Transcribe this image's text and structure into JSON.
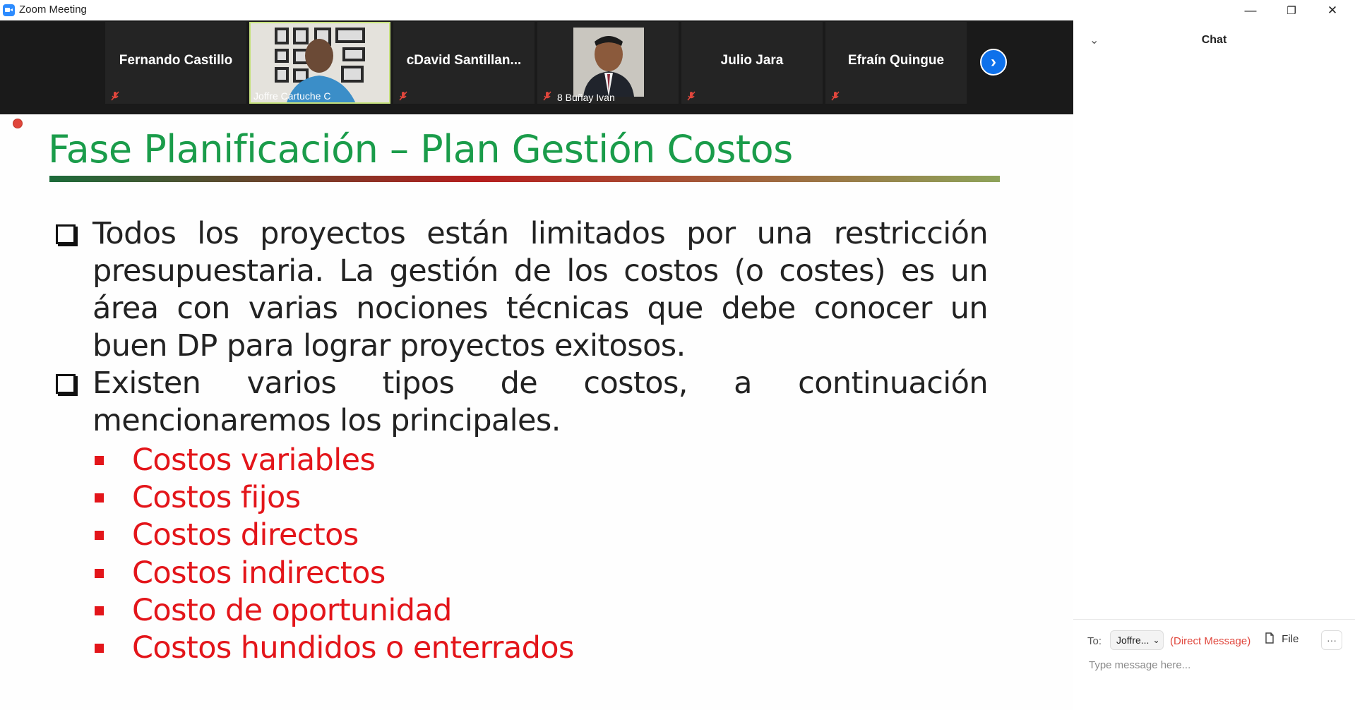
{
  "window": {
    "title": "Zoom Meeting",
    "minimize": "—",
    "restore": "❐",
    "close": "✕"
  },
  "participants": [
    {
      "name": "Fernando Castillo"
    },
    {
      "name": "Joffre Cartuche C"
    },
    {
      "name": "cDavid  Santillan..."
    },
    {
      "name": "8 Buñay Ivan"
    },
    {
      "name": "Julio Jara"
    },
    {
      "name": "Efraín Quingue"
    }
  ],
  "next_icon": "›",
  "slide": {
    "title": "Fase Planificación – Plan Gestión Costos",
    "bullets": [
      "Todos los proyectos están limitados por una restricción presupuestaria. La gestión de los costos (o costes) es un área con varias nociones técnicas que debe conocer un buen DP para lograr proyectos exitosos.",
      "Existen varios tipos de costos, a continuación mencionaremos los principales."
    ],
    "sub_items": [
      "Costos variables",
      "Costos fijos",
      "Costos directos",
      "Costos indirectos",
      "Costo de oportunidad",
      "Costos hundidos o enterrados"
    ],
    "colors": {
      "title": "#1a9c4a",
      "sub_items": "#e3151a"
    }
  },
  "chat": {
    "collapse_icon": "⌄",
    "title": "Chat",
    "to_label": "To:",
    "recipient": "Joffre...",
    "recipient_arrow": "⌄",
    "direct_message": "(Direct Message)",
    "file_label": "File",
    "more_label": "···",
    "placeholder": "Type message here..."
  }
}
